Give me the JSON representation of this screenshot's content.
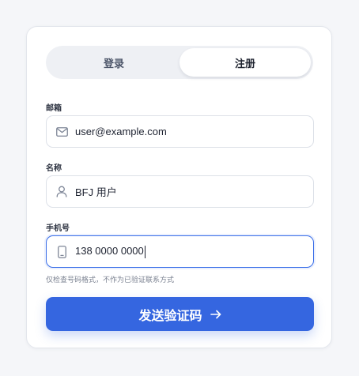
{
  "tabs": [
    {
      "label": "登录",
      "active": false
    },
    {
      "label": "注册",
      "active": true
    }
  ],
  "form": {
    "email": {
      "label": "邮箱",
      "value": "user@example.com",
      "icon": "mail-icon"
    },
    "name": {
      "label": "名称",
      "value": "BFJ 用户",
      "icon": "user-icon"
    },
    "phone": {
      "label": "手机号",
      "value": "138 0000 0000",
      "icon": "phone-icon",
      "focused": true
    },
    "phone_hint": "仅检查号码格式，不作为已验证联系方式"
  },
  "submit": {
    "label": "发送验证码",
    "icon": "arrow-right-icon"
  },
  "colors": {
    "accent": "#3566e0",
    "focus_border": "#3a6ee8",
    "background": "#f5f6f9"
  }
}
